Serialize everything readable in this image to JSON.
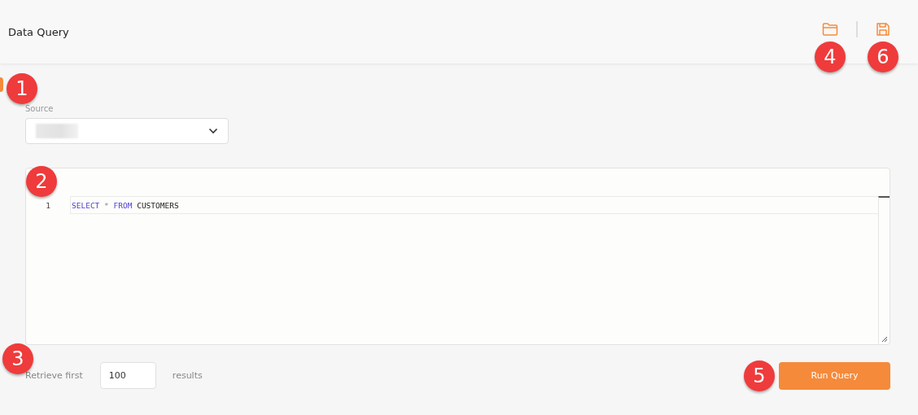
{
  "header": {
    "title": "Data Query",
    "tools": [
      {
        "kind": "folder",
        "callout": "4"
      },
      {
        "kind": "save",
        "callout": "6"
      }
    ]
  },
  "source": {
    "label": "Source",
    "callout": "1"
  },
  "editor": {
    "callout": "2",
    "lines": [
      {
        "number": "1",
        "tokens": [
          {
            "kind": "keyword",
            "text": "SELECT"
          },
          {
            "kind": "operator",
            "text": "*"
          },
          {
            "kind": "keyword",
            "text": "FROM"
          },
          {
            "kind": "identifier",
            "text": "CUSTOMERS"
          }
        ]
      }
    ]
  },
  "limit": {
    "prefix": "Retrieve first",
    "value": "100",
    "suffix": "results",
    "callout": "3"
  },
  "run_button": {
    "label": "Run Query",
    "callout": "5"
  }
}
